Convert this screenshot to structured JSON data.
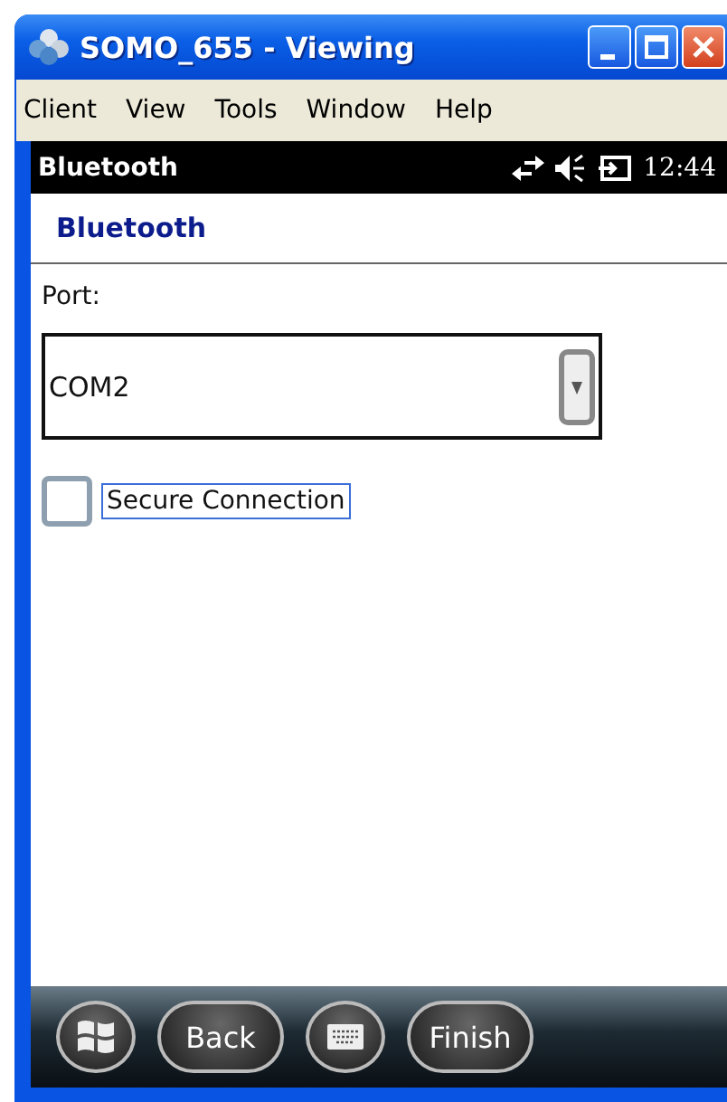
{
  "window": {
    "title": "SOMO_655 - Viewing"
  },
  "menu": [
    "Client",
    "View",
    "Tools",
    "Window",
    "Help"
  ],
  "status_bar": {
    "title": "Bluetooth",
    "time": "12:44"
  },
  "page_title": "Bluetooth",
  "port": {
    "label": "Port:",
    "value": "COM2"
  },
  "secure_connection": {
    "label": "Secure Connection",
    "checked": false,
    "focused": true
  },
  "softkeys": [
    {
      "kind": "start"
    },
    {
      "kind": "text",
      "label": "Back"
    },
    {
      "kind": "keyboard"
    },
    {
      "kind": "text",
      "label": "Finish"
    }
  ]
}
